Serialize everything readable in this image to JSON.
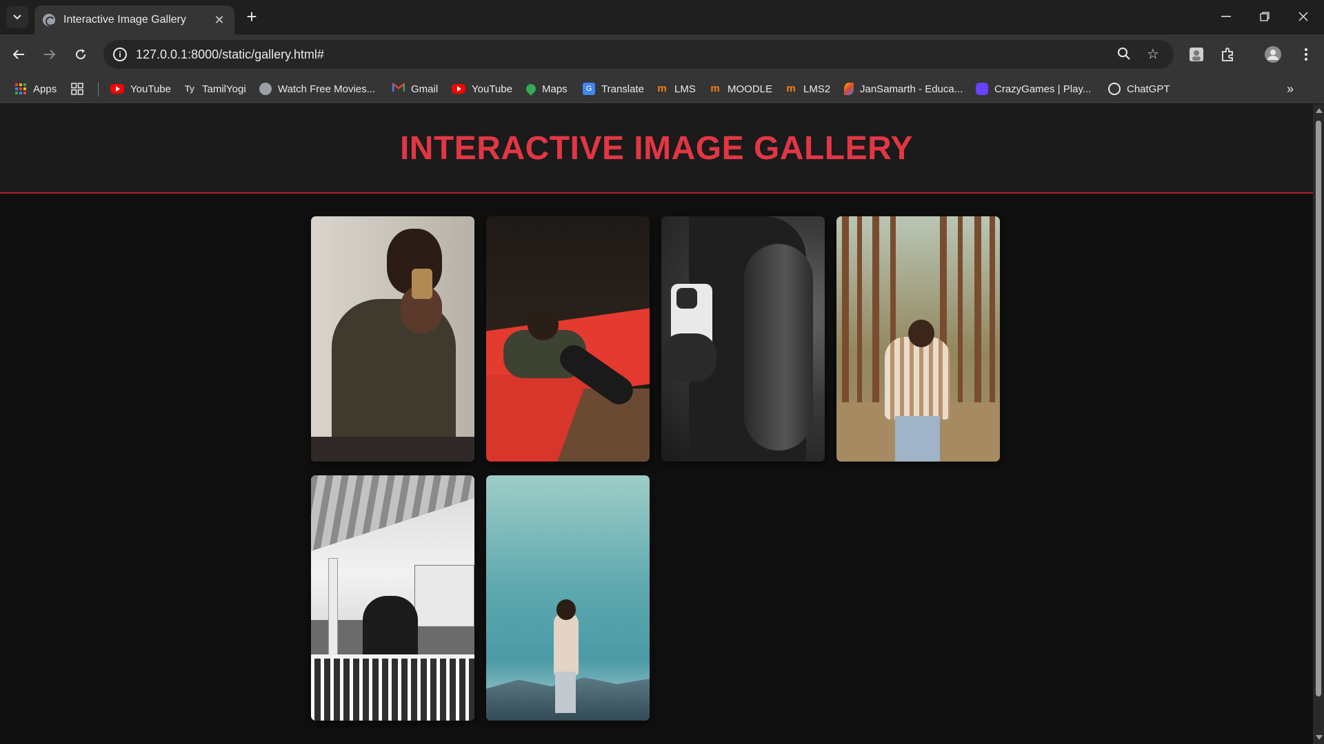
{
  "browser": {
    "tab_title": "Interactive Image Gallery",
    "url": "127.0.0.1:8000/static/gallery.html#",
    "bookmarks": [
      {
        "label": "Apps",
        "icon": "apps-icon"
      },
      {
        "label": "YouTube",
        "icon": "youtube-icon"
      },
      {
        "label": "TamilYogi",
        "icon": "tamilyogi-icon"
      },
      {
        "label": "Watch Free Movies...",
        "icon": "globe-icon"
      },
      {
        "label": "Gmail",
        "icon": "gmail-icon"
      },
      {
        "label": "YouTube",
        "icon": "youtube-icon"
      },
      {
        "label": "Maps",
        "icon": "maps-icon"
      },
      {
        "label": "Translate",
        "icon": "translate-icon"
      },
      {
        "label": "LMS",
        "icon": "moodle-icon"
      },
      {
        "label": "MOODLE",
        "icon": "moodle-icon"
      },
      {
        "label": "LMS2",
        "icon": "moodle-icon"
      },
      {
        "label": "JanSamarth - Educa...",
        "icon": "jansamarth-icon"
      },
      {
        "label": "CrazyGames | Play...",
        "icon": "crazygames-icon"
      },
      {
        "label": "ChatGPT",
        "icon": "chatgpt-icon"
      }
    ]
  },
  "page": {
    "title": "INTERACTIVE IMAGE GALLERY",
    "accent_color": "#e23644",
    "photos": [
      {
        "subject": "mirror-selfie"
      },
      {
        "subject": "red-couch"
      },
      {
        "subject": "monochrome-arm-phone"
      },
      {
        "subject": "forest-portrait"
      },
      {
        "subject": "monochrome-balcony"
      },
      {
        "subject": "mountain-sky"
      }
    ]
  }
}
